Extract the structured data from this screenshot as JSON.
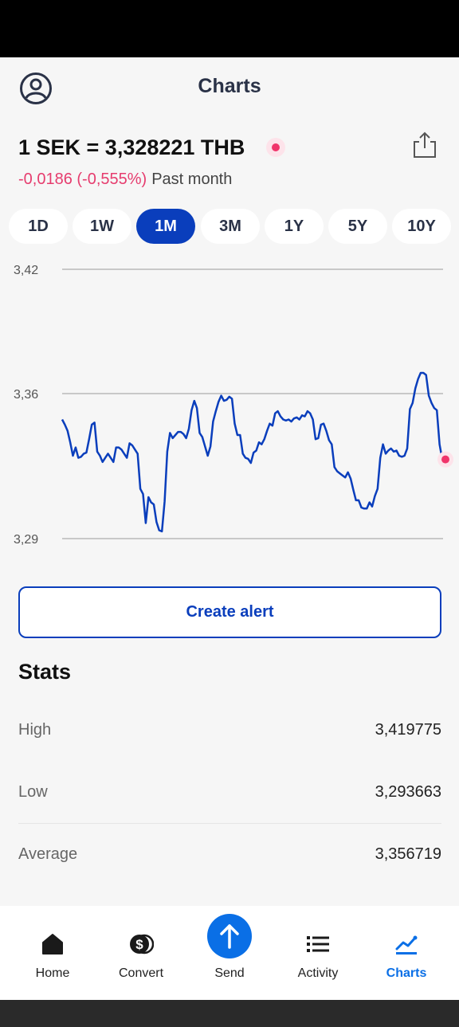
{
  "header": {
    "title": "Charts"
  },
  "rate": {
    "text": "1 SEK = 3,328221 THB"
  },
  "change": {
    "value": "-0,0186 (-0,555%)",
    "period": "Past month"
  },
  "periods": [
    {
      "label": "1D",
      "active": false
    },
    {
      "label": "1W",
      "active": false
    },
    {
      "label": "1M",
      "active": true
    },
    {
      "label": "3M",
      "active": false
    },
    {
      "label": "1Y",
      "active": false
    },
    {
      "label": "5Y",
      "active": false
    },
    {
      "label": "10Y",
      "active": false
    }
  ],
  "chart_data": {
    "type": "line",
    "title": "",
    "xlabel": "",
    "ylabel": "",
    "ylim": [
      3.29,
      3.42
    ],
    "yticks": [
      "3,42",
      "3,36",
      "3,29"
    ],
    "ytick_values": [
      3.42,
      3.36,
      3.29
    ],
    "grid": true,
    "color": "#0a3ebc",
    "end_marker_color": "#f0346a",
    "series": [
      {
        "values": [
          3.3475,
          3.345,
          3.342,
          3.3365,
          3.33,
          3.334,
          3.329,
          3.3295,
          3.331,
          3.3315,
          3.338,
          3.345,
          3.346,
          3.332,
          3.33,
          3.327,
          3.329,
          3.331,
          3.329,
          3.327,
          3.334,
          3.334,
          3.333,
          3.331,
          3.329,
          3.336,
          3.335,
          3.333,
          3.331,
          3.314,
          3.3115,
          3.2975,
          3.31,
          3.3075,
          3.3065,
          3.298,
          3.294,
          3.2935,
          3.308,
          3.332,
          3.341,
          3.3385,
          3.34,
          3.3415,
          3.3415,
          3.3405,
          3.3385,
          3.343,
          3.352,
          3.3565,
          3.353,
          3.341,
          3.339,
          3.3345,
          3.33,
          3.3345,
          3.3465,
          3.3515,
          3.356,
          3.359,
          3.3565,
          3.357,
          3.3585,
          3.3575,
          3.3455,
          3.34,
          3.34,
          3.331,
          3.329,
          3.3285,
          3.3265,
          3.3315,
          3.3325,
          3.3365,
          3.3355,
          3.338,
          3.342,
          3.3455,
          3.3445,
          3.3505,
          3.3515,
          3.349,
          3.3475,
          3.347,
          3.3475,
          3.3465,
          3.348,
          3.3485,
          3.3475,
          3.3495,
          3.349,
          3.3515,
          3.3505,
          3.3475,
          3.338,
          3.3385,
          3.345,
          3.3455,
          3.342,
          3.3375,
          3.3355,
          3.3245,
          3.3225,
          3.3215,
          3.3205,
          3.3195,
          3.322,
          3.319,
          3.3135,
          3.3085,
          3.3085,
          3.305,
          3.3045,
          3.3045,
          3.3075,
          3.3055,
          3.3105,
          3.314,
          3.329,
          3.3355,
          3.331,
          3.3325,
          3.3335,
          3.332,
          3.3325,
          3.33,
          3.3295,
          3.33,
          3.3335,
          3.3525,
          3.3555,
          3.3625,
          3.367,
          3.37,
          3.37,
          3.369,
          3.359,
          3.3555,
          3.353,
          3.352,
          3.3355,
          3.328221
        ],
        "dates_shown": false
      }
    ]
  },
  "alert_button": {
    "label": "Create alert"
  },
  "stats": {
    "title": "Stats",
    "rows": [
      {
        "label": "High",
        "value": "3,419775"
      },
      {
        "label": "Low",
        "value": "3,293663"
      },
      {
        "label": "Average",
        "value": "3,356719"
      }
    ]
  },
  "nav": {
    "items": [
      {
        "label": "Home",
        "icon": "home-icon"
      },
      {
        "label": "Convert",
        "icon": "coins-icon"
      },
      {
        "label": "Send",
        "icon": "send-arrow-icon"
      },
      {
        "label": "Activity",
        "icon": "list-icon"
      },
      {
        "label": "Charts",
        "icon": "chart-icon"
      }
    ],
    "active_color": "#0a6fe6"
  }
}
